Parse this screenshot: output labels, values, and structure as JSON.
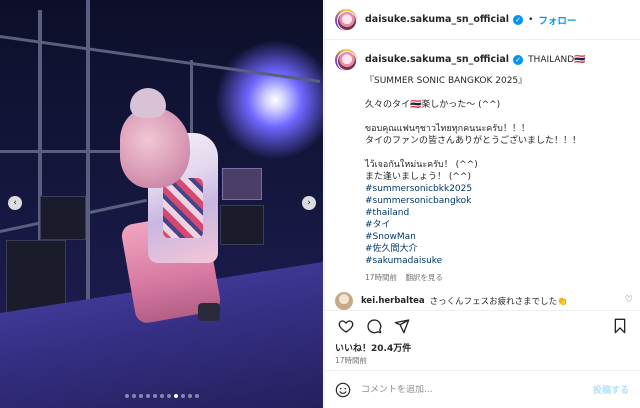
{
  "header": {
    "username": "daisuke.sakuma_sn_official",
    "separator": "•",
    "follow_label": "フォロー"
  },
  "caption": {
    "username": "daisuke.sakuma_sn_official",
    "location": "THAILAND🇹🇭",
    "lines": [
      "『SUMMER SONIC BANGKOK 2025』",
      "",
      "久々のタイ🇹🇭楽しかった〜 (^^)",
      "",
      "ขอบคุณแฟนๆชาวไทยทุกคนนะครับ！！！",
      "タイのファンの皆さんありがとうございました！！！",
      "",
      "ไว้เจอกันใหม่นะครับ！ (^^)",
      "また逢いましょう！ (^^)"
    ],
    "hashtags": [
      "#summersonicbkk2025",
      "#summersonicbangkok",
      "#thailand",
      "#タイ",
      "#SnowMan",
      "#佐久間大介",
      "#sakumadaisuke"
    ],
    "time": "17時間前",
    "translate_label": "翻訳を見る"
  },
  "comment": {
    "username": "kei.herbaltea",
    "text": "さっくんフェスお疲れさまでした👏"
  },
  "likes_label": "いいね！20.4万件",
  "post_time": "17時間前",
  "comment_bar": {
    "placeholder": "コメントを追加...",
    "post_label": "投稿する"
  },
  "carousel": {
    "slide_count": 11,
    "active_index": 7
  },
  "icons": {
    "verified": "verified-badge-icon",
    "like": "heart-icon",
    "comment": "comment-icon",
    "share": "share-icon",
    "save": "bookmark-icon",
    "emoji": "smiley-icon",
    "prev": "chevron-left-icon",
    "next": "chevron-right-icon",
    "comment_like": "small-heart-icon"
  },
  "colors": {
    "link": "#0095f6",
    "hashtag": "#00376b",
    "muted": "#737373"
  }
}
